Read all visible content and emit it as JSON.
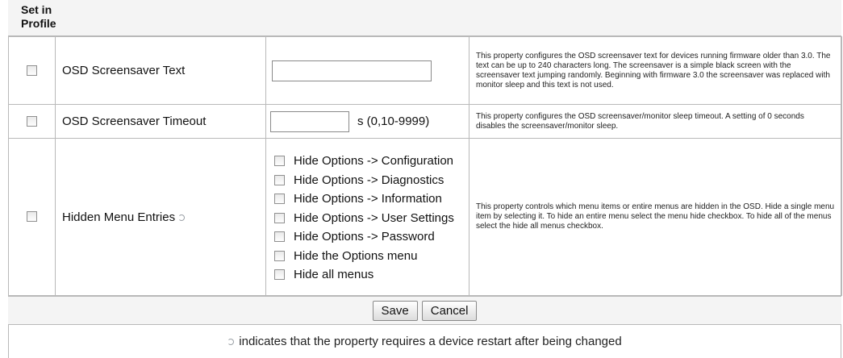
{
  "header": {
    "column_label": "Set in Profile"
  },
  "rows": [
    {
      "label": "OSD Screensaver Text",
      "description": "This property configures the OSD screensaver text for devices running firmware older than 3.0. The text can be up to 240 characters long. The screensaver is a simple black screen with the screensaver text jumping randomly. Beginning with firmware 3.0 the screensaver was replaced with monitor sleep and this text is not used.",
      "value": ""
    },
    {
      "label": "OSD Screensaver Timeout",
      "unit": "s (0,10-9999)",
      "description": "This property configures the OSD screensaver/monitor sleep timeout. A setting of 0 seconds disables the screensaver/monitor sleep.",
      "value": ""
    },
    {
      "label": "Hidden Menu Entries",
      "description": "This property controls which menu items or entire menus are hidden in the OSD. Hide a single menu item by selecting it. To hide an entire menu select the menu hide checkbox. To hide all of the menus select the hide all menus checkbox.",
      "options": [
        "Hide Options -> Configuration",
        "Hide Options -> Diagnostics",
        "Hide Options -> Information",
        "Hide Options -> User Settings",
        "Hide Options -> Password",
        "Hide the Options menu",
        "Hide all menus"
      ]
    }
  ],
  "buttons": {
    "save": "Save",
    "cancel": "Cancel"
  },
  "footnote": "indicates that the property requires a device restart after being changed",
  "icons": {
    "restart": "restart-required-icon"
  }
}
